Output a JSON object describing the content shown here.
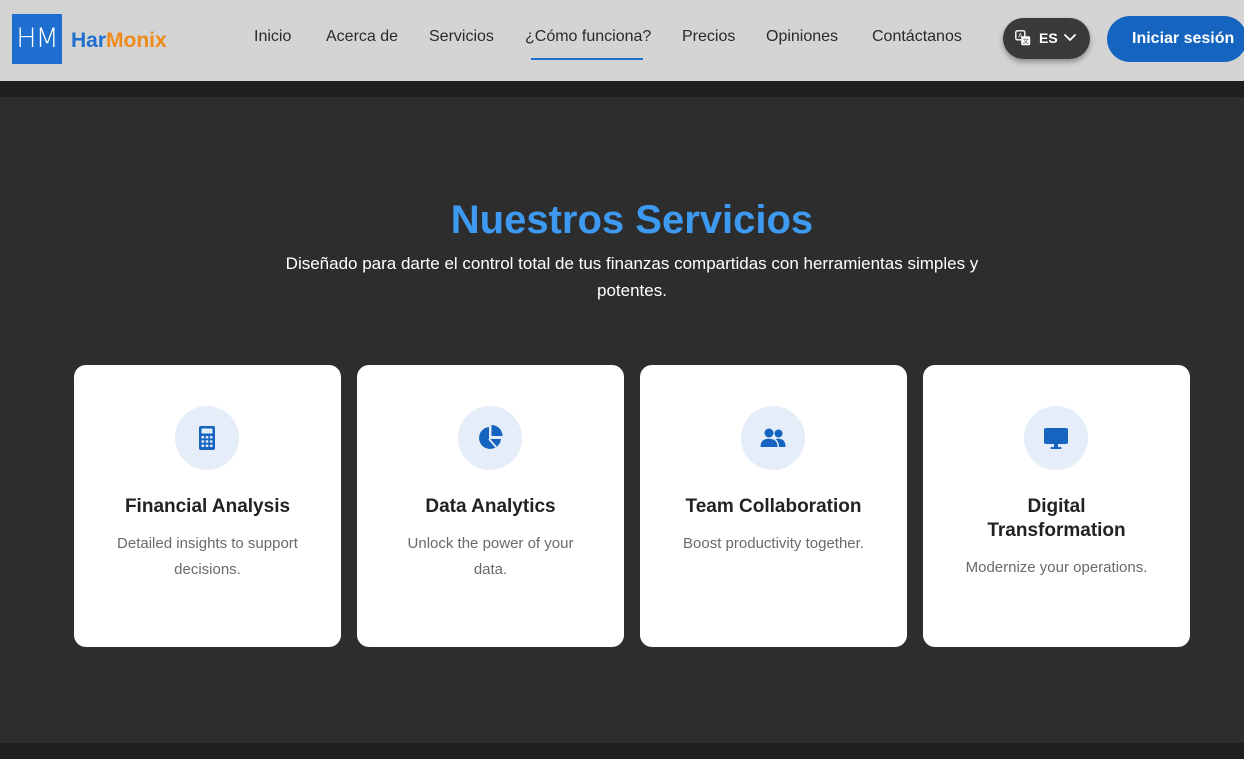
{
  "brand": {
    "logo_text": "HM",
    "name_part1": "Har",
    "name_part2": "Monix",
    "accent_blue": "#1e6fcf",
    "accent_orange": "#f08a1c"
  },
  "nav": {
    "items": [
      {
        "label": "Inicio"
      },
      {
        "label": "Acerca de"
      },
      {
        "label": "Servicios"
      },
      {
        "label": "¿Cómo funciona?",
        "active": true
      },
      {
        "label": "Precios"
      },
      {
        "label": "Opiniones"
      },
      {
        "label": "Contáctanos"
      }
    ]
  },
  "language": {
    "code": "ES",
    "icon": "translate-icon"
  },
  "login_button": "Iniciar sesión",
  "services": {
    "title": "Nuestros Servicios",
    "subtitle": "Diseñado para darte el control total de tus finanzas compartidas con herramientas simples y potentes.",
    "cards": [
      {
        "icon": "calculator-icon",
        "title": "Financial Analysis",
        "description": "Detailed insights to support decisions."
      },
      {
        "icon": "pie-chart-icon",
        "title": "Data Analytics",
        "description": "Unlock the power of your data."
      },
      {
        "icon": "users-icon",
        "title": "Team Collaboration",
        "description": "Boost productivity together."
      },
      {
        "icon": "monitor-icon",
        "title": "Digital Transformation",
        "description": "Modernize your operations."
      }
    ]
  },
  "colors": {
    "title_blue": "#3d9af0",
    "button_blue": "#1565c0",
    "section_bg": "#2d2d2d"
  }
}
